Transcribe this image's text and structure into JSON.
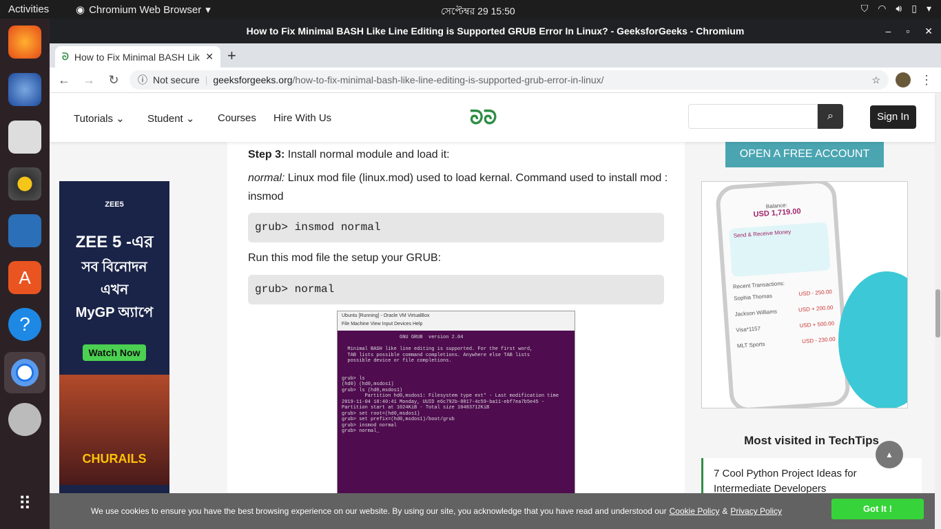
{
  "topbar": {
    "activities": "Activities",
    "app": "Chromium Web Browser",
    "clock": "সেপ্টেম্বর 29  15:50"
  },
  "window": {
    "title": "How to Fix Minimal BASH Like Line Editing is Supported GRUB Error In Linux? - GeeksforGeeks - Chromium"
  },
  "tab": {
    "title": "How to Fix Minimal BASH Like"
  },
  "omnibox": {
    "security": "Not secure",
    "domain": "geeksforgeeks.org",
    "path": "/how-to-fix-minimal-bash-like-line-editing-is-supported-grub-error-in-linux/"
  },
  "nav": {
    "tutorials": "Tutorials",
    "student": "Student",
    "courses": "Courses",
    "hire": "Hire With Us",
    "logo": "ᘐᘐ",
    "signin": "Sign In"
  },
  "article": {
    "step3_bold": "Step 3:",
    "step3_text": " Install normal module and load it:",
    "normal_italic": "normal:",
    "normal_text": " Linux mod file (linux.mod) used to load kernal. Command used to install mod : insmod",
    "code1": "grub> insmod normal",
    "run_text": "Run this mod file the setup your GRUB:",
    "code2": "grub> normal",
    "shot_title": "Ubuntu [Running] - Oracle VM VirtualBox",
    "shot_menu": "File   Machine   View   Input   Devices   Help",
    "shot_body": "                    GNU GRUB  version 2.04\n\n  Minimal BASH like line editing is supported. For the first word,\n  TAB lists possible command completions. Anywhere else TAB lists\n  possible device or file completions.\n\n\ngrub> ls\n(hd0) (hd0,msdos1)\ngrub> ls (hd0,msdos1)\n        Partition hd0,msdos1: Filesystem type ext* - Last modification time\n2019-11-04 18:40:41 Monday, UUID e6c792b-8817-4c59-ba11-ebf7ea7b5e45 -\nPartition start at 1024KiB - Total size 10483712KiB\ngrub> set root=(hd0,msdos1)\ngrub> set prefix=(hd0,msdos1)/boot/grub\ngrub> insmod normal\ngrub> normal_"
  },
  "leftad": {
    "brand": "ZEE5",
    "line1": "ZEE 5 -এর",
    "line2": "সব বিনোদন",
    "line3": "এখন",
    "line4": "MyGP অ্যাপে",
    "cta": "Watch Now",
    "poster": "CHURAILS"
  },
  "rightcol": {
    "free_account": "OPEN A FREE ACCOUNT",
    "balance_label": "Balance:",
    "balance": "USD 1,719.00",
    "send": "Send & Receive Money",
    "recent": "Recent Transactions:",
    "t1": "Sophia Thomas",
    "t1amt": "USD - 250.00",
    "t2": "Jackson Williams",
    "t2amt": "USD + 200.00",
    "t3": "Visa*1157",
    "t3amt": "USD + 500.00",
    "t4": "MLT Sports",
    "t4amt": "USD - 230.00",
    "most_visited": "Most visited in TechTips",
    "item1": "7 Cool Python Project Ideas for Intermediate Developers"
  },
  "cookie": {
    "text": "We use cookies to ensure you have the best browsing experience on our website. By using our site, you acknowledge that you have read and understood our",
    "policy": "Cookie Policy",
    "amp": "&",
    "privacy": "Privacy Policy",
    "gotit": "Got It !"
  },
  "icons": [
    "firefox-icon",
    "thunderbird-icon",
    "files-icon",
    "rhythmbox-icon",
    "writer-icon",
    "software-icon",
    "help-icon",
    "chromium-icon",
    "disc-icon",
    "apps-grid-icon"
  ]
}
